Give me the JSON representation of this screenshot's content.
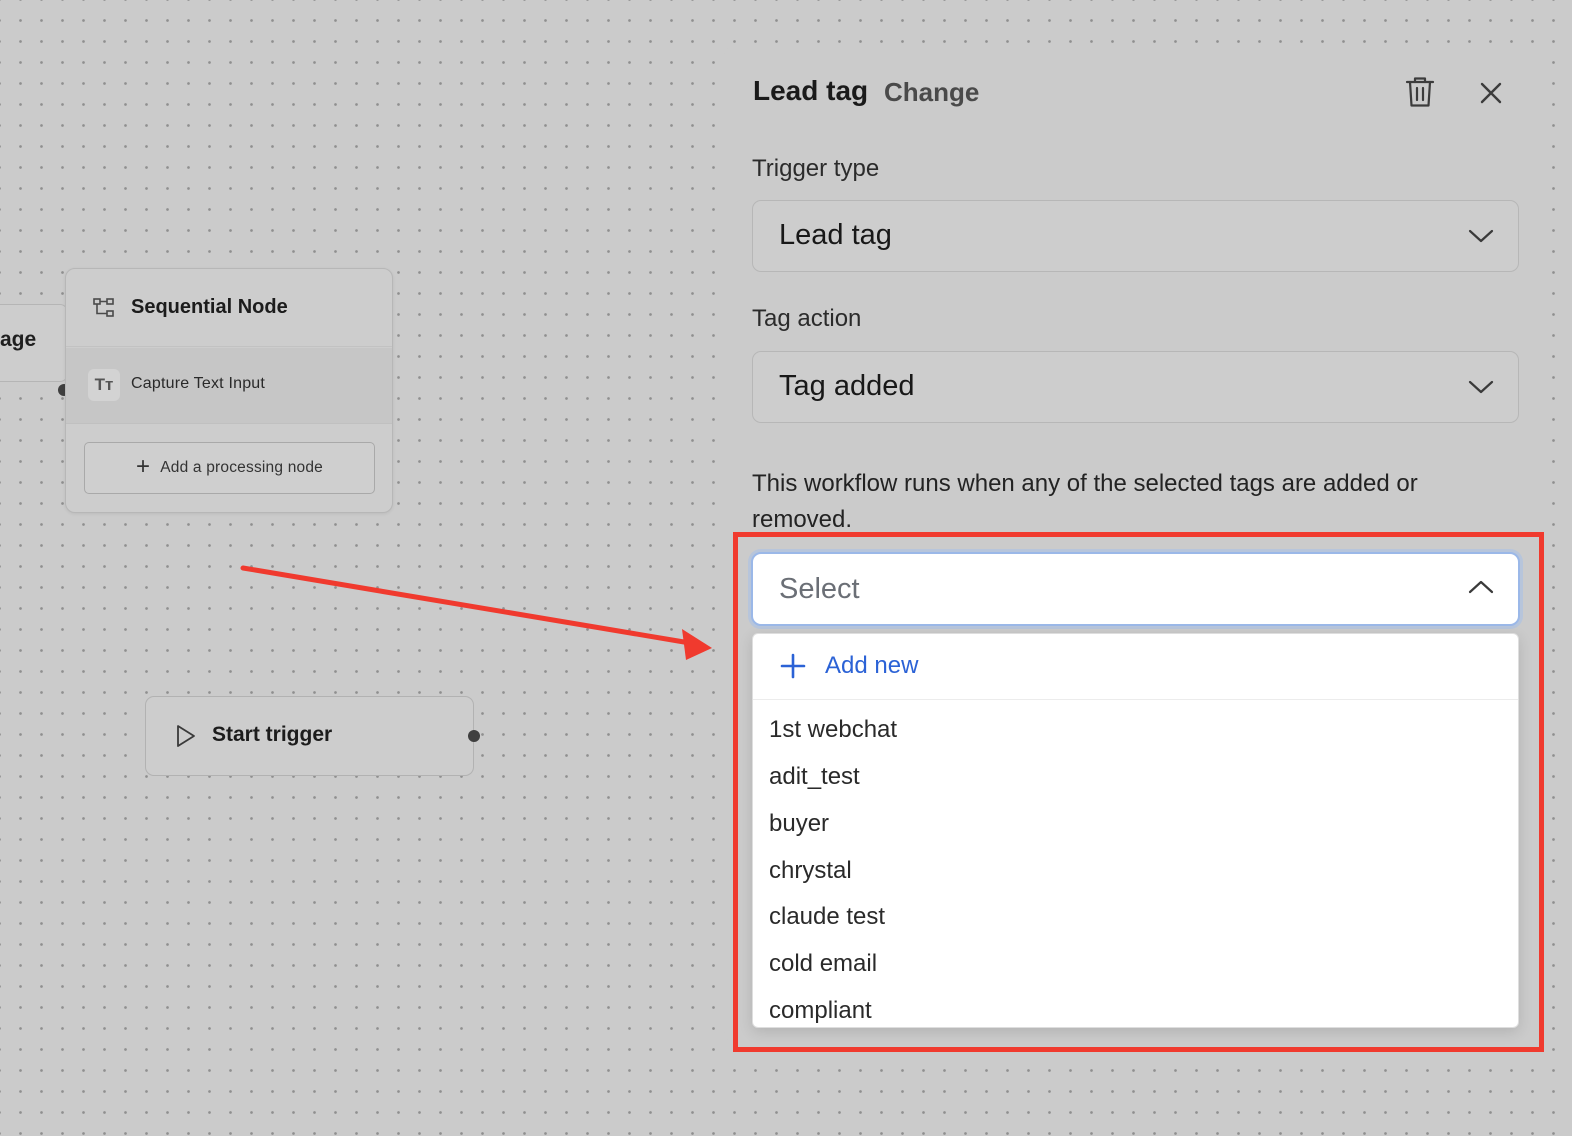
{
  "canvas": {
    "partial_node_label": "age",
    "sequential_node": {
      "title": "Sequential Node",
      "step_label": "Capture Text Input",
      "step_icon_text": "Tт",
      "add_button_label": "Add a processing node"
    },
    "start_node": {
      "label": "Start trigger"
    }
  },
  "panel": {
    "title": "Lead tag",
    "change_label": "Change",
    "trigger_type": {
      "label": "Trigger type",
      "value": "Lead tag"
    },
    "tag_action": {
      "label": "Tag action",
      "value": "Tag added"
    },
    "description": "This workflow runs when any of the selected tags are added or removed.",
    "tag_select": {
      "placeholder": "Select",
      "add_new_label": "Add new",
      "options": [
        "1st webchat",
        "adit_test",
        "buyer",
        "chrystal",
        "claude test",
        "cold email",
        "compliant"
      ]
    }
  },
  "colors": {
    "annotation": "#f03a2e",
    "accent": "#2b62d6",
    "overlay_gray": "#cbcbcb"
  },
  "icons": [
    "sequential-node-icon",
    "text-input-icon",
    "plus-icon",
    "play-icon",
    "trash-icon",
    "close-icon",
    "chevron-down-icon",
    "chevron-up-icon"
  ]
}
